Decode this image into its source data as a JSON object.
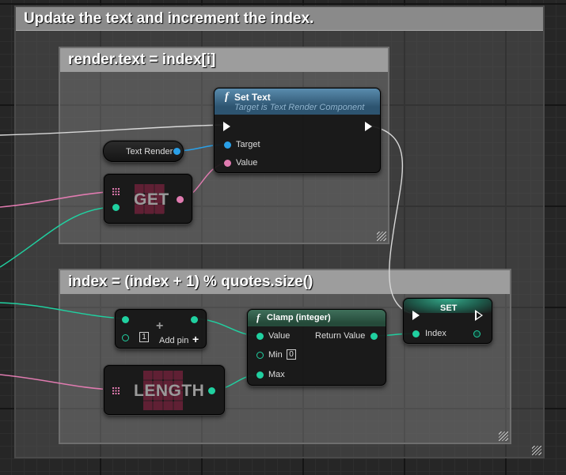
{
  "comments": {
    "outer": "Update the text and increment the index.",
    "render_text": "render.text = index[i]",
    "index_update": "index = (index + 1) % quotes.size()"
  },
  "nodes": {
    "set_text": {
      "func_icon": "f",
      "title": "Set Text",
      "subtitle": "Target is Text Render Component",
      "target_label": "Target",
      "value_label": "Value"
    },
    "text_render": {
      "label": "Text Render"
    },
    "get": {
      "label": "GET"
    },
    "add": {
      "default_value": "1",
      "add_pin_label": "Add pin",
      "plus_icon": "+"
    },
    "length": {
      "label": "LENGTH"
    },
    "clamp": {
      "func_icon": "f",
      "title": "Clamp (integer)",
      "value_label": "Value",
      "min_label": "Min",
      "min_value": "0",
      "max_label": "Max",
      "return_label": "Return Value"
    },
    "set": {
      "title": "SET",
      "index_label": "Index"
    }
  },
  "colors": {
    "exec": "#ffffff",
    "object_pin": "#2aa0e8",
    "integer_pin": "#20d0a0",
    "array_pin": "#e07bb0",
    "function_header": "#3f6f8f",
    "variable_header": "#1f6e5c",
    "comment_header": "#9d9d9d"
  }
}
